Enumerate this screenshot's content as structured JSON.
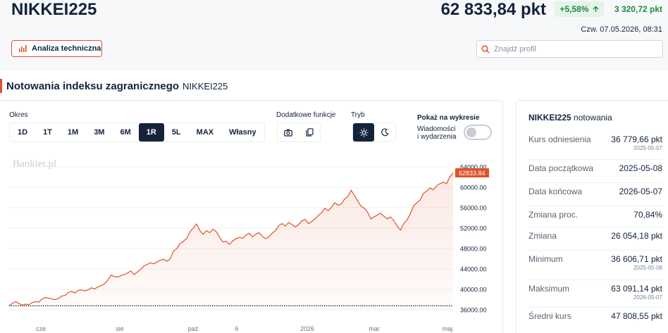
{
  "header": {
    "title": "NIKKEI225",
    "price": "62 833,84 pkt",
    "change_pct": "+5,58%",
    "change_abs": "3 320,72 pkt",
    "datetime": "Czw. 07.05.2026, 08:31",
    "ta_button_label": "Analiza techniczna",
    "search_placeholder": "Znajdź profil"
  },
  "section": {
    "title": "Notowania indeksu zagranicznego",
    "subtitle": "NIKKEI225"
  },
  "controls": {
    "period_label": "Okres",
    "periods": [
      "1D",
      "1T",
      "1M",
      "3M",
      "6M",
      "1R",
      "5L",
      "MAX",
      "Własny"
    ],
    "active_period": "1R",
    "extra_label": "Dodatkowe funkcje",
    "mode_label": "Tryb",
    "show_label": "Pokaż na wykresie",
    "toggle_line1": "Wiadomości",
    "toggle_line2": "i wydarzenia",
    "toggle_on": false
  },
  "chart": {
    "watermark": "Bankier.pl",
    "current_label": "62833.84"
  },
  "chart_data": {
    "type": "area",
    "x": [
      "2025-05",
      "2025-06",
      "2025-07",
      "2025-08",
      "2025-09",
      "2025-10",
      "2025-11",
      "2025-12",
      "2026-01",
      "2026-02",
      "2026-03",
      "2026-04",
      "2026-05"
    ],
    "x_tick_labels": [
      "cze",
      "sie",
      "paź",
      "6",
      "2026",
      "mar",
      "maj"
    ],
    "y_tick_labels": [
      "64000.00",
      "60000.00",
      "56000.00",
      "52000.00",
      "48000.00",
      "44000.00",
      "40000.00",
      "36000.00"
    ],
    "ylim": [
      36000,
      64000
    ],
    "reference_line": 36779.66,
    "last_value": 62833.84,
    "series": [
      {
        "values": [
          36780,
          37300,
          37600,
          37200,
          36900,
          37100,
          37000,
          37400,
          37600,
          37500,
          38100,
          38400,
          38300,
          38100,
          38000,
          38200,
          38700,
          38800,
          39400,
          39600,
          39300,
          39800,
          39900,
          39700,
          39900,
          40300,
          40100,
          40500,
          40700,
          41100,
          41800,
          42800,
          42500,
          42400,
          42700,
          42900,
          43200,
          43600,
          42900,
          43400,
          43900,
          44600,
          44900,
          45200,
          45000,
          45400,
          45700,
          45900,
          45500,
          46000,
          47500,
          48000,
          49000,
          49400,
          50000,
          51300,
          52000,
          52800,
          51500,
          50800,
          51500,
          51100,
          51800,
          51300,
          50200,
          49300,
          49400,
          48800,
          49500,
          49900,
          50200,
          50000,
          50600,
          51000,
          50300,
          50800,
          51100,
          50400,
          49900,
          50300,
          51000,
          51500,
          52500,
          52900,
          52400,
          53100,
          52700,
          52200,
          52700,
          53400,
          53700,
          52900,
          53300,
          53800,
          54500,
          55000,
          55900,
          55400,
          56100,
          57000,
          56500,
          56700,
          57700,
          58200,
          59400,
          58400,
          57300,
          56300,
          55900,
          55100,
          53800,
          54200,
          54600,
          54900,
          54300,
          53800,
          54200,
          53400,
          52400,
          51600,
          52900,
          53600,
          54800,
          56400,
          57000,
          57500,
          58800,
          59300,
          59900,
          59500,
          60300,
          60700,
          61000,
          60700,
          62000,
          62833.84
        ]
      }
    ]
  },
  "side": {
    "title_bold": "NIKKEI225",
    "title_rest": "notowania",
    "stats": [
      {
        "label": "Kurs odniesienia",
        "value": "36 779,66 pkt",
        "date": "2025-05-07"
      },
      {
        "label": "Data początkowa",
        "value": "2025-05-08",
        "date": ""
      },
      {
        "label": "Data końcowa",
        "value": "2026-05-07",
        "date": ""
      },
      {
        "label": "Zmiana proc.",
        "value": "70,84%",
        "date": ""
      },
      {
        "label": "Zmiana",
        "value": "26 054,18 pkt",
        "date": ""
      },
      {
        "label": "Minimum",
        "value": "36 606,71 pkt",
        "date": "2025-05-08"
      },
      {
        "label": "Maksimum",
        "value": "63 091,14 pkt",
        "date": "2026-05-07"
      },
      {
        "label": "Średni kurs",
        "value": "47 808,55 pkt",
        "date": ""
      }
    ]
  },
  "colors": {
    "accent": "#e0512a",
    "navy": "#14233c",
    "positive": "#1e8c3e"
  }
}
